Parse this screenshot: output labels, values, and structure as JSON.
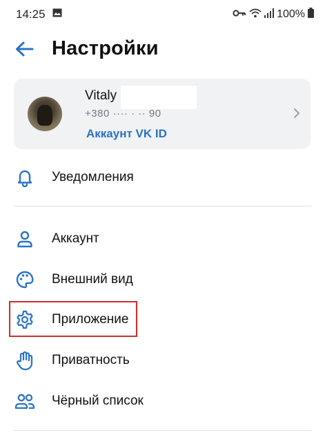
{
  "status_bar": {
    "time": "14:25",
    "battery": "100%"
  },
  "header": {
    "title": "Настройки"
  },
  "profile": {
    "name": "Vitaly",
    "phone": "+380 ···· · ·· 90",
    "vk_id_link": "Аккаунт VK ID"
  },
  "menu": {
    "items": [
      {
        "label": "Уведомления",
        "icon": "bell-icon"
      },
      {
        "label": "Аккаунт",
        "icon": "person-icon"
      },
      {
        "label": "Внешний вид",
        "icon": "palette-icon"
      },
      {
        "label": "Приложение",
        "icon": "gear-icon",
        "highlighted": true
      },
      {
        "label": "Приватность",
        "icon": "hand-icon"
      },
      {
        "label": "Чёрный список",
        "icon": "users-icon"
      }
    ]
  },
  "colors": {
    "accent": "#2a73c5",
    "card_bg": "#f1f2f4",
    "highlight": "#d22a2a"
  }
}
